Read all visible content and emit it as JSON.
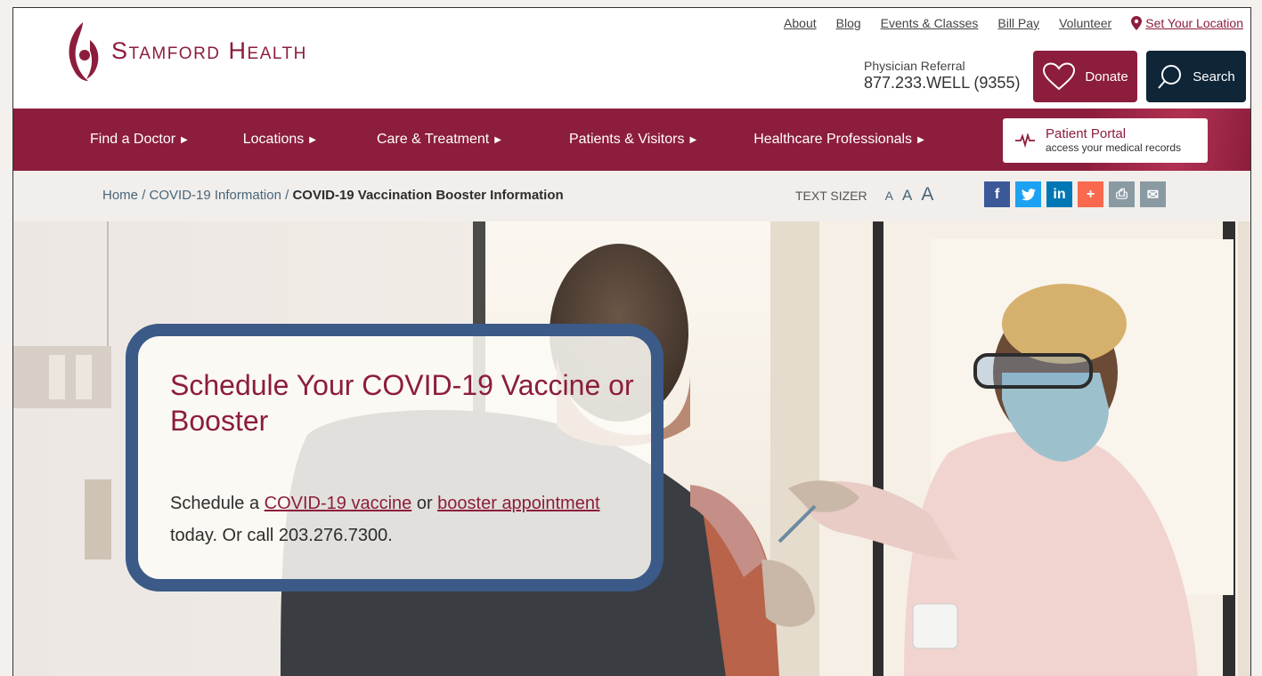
{
  "brand": {
    "name": "Stamford Health",
    "color": "#8c1d3c"
  },
  "utility_links": [
    "About",
    "Blog",
    "Events & Classes",
    "Bill Pay",
    "Volunteer"
  ],
  "location_link": "Set Your Location",
  "referral": {
    "label": "Physician Referral",
    "phone": "877.233.WELL (9355)"
  },
  "buttons": {
    "donate": "Donate",
    "search": "Search"
  },
  "nav": {
    "items": [
      "Find a Doctor",
      "Locations",
      "Care & Treatment",
      "Patients & Visitors",
      "Healthcare Professionals"
    ],
    "portal": {
      "title": "Patient Portal",
      "subtitle": "access your medical records"
    }
  },
  "breadcrumb": {
    "home": "Home",
    "section": "COVID-19 Information",
    "current": "COVID-19 Vaccination Booster Information"
  },
  "text_sizer": {
    "label": "TEXT SIZER",
    "small": "A",
    "medium": "A",
    "large": "A"
  },
  "share": [
    {
      "icon": "facebook-icon",
      "glyph": "f",
      "color": "#3b5998"
    },
    {
      "icon": "twitter-icon",
      "glyph": "🐦",
      "color": "#1da1f2"
    },
    {
      "icon": "linkedin-icon",
      "glyph": "in",
      "color": "#0077b5"
    },
    {
      "icon": "addthis-icon",
      "glyph": "+",
      "color": "#f8694d"
    },
    {
      "icon": "print-icon",
      "glyph": "⎙",
      "color": "#8a9aa3"
    },
    {
      "icon": "email-icon",
      "glyph": "✉",
      "color": "#8a9aa3"
    }
  ],
  "hero": {
    "title": "Schedule Your COVID-19 Vaccine or Booster",
    "text_before": "Schedule a ",
    "link1": "COVID-19 vaccine",
    "text_middle": " or ",
    "link2": "booster appointment",
    "text_after": " today. Or call 203.276.7300."
  }
}
